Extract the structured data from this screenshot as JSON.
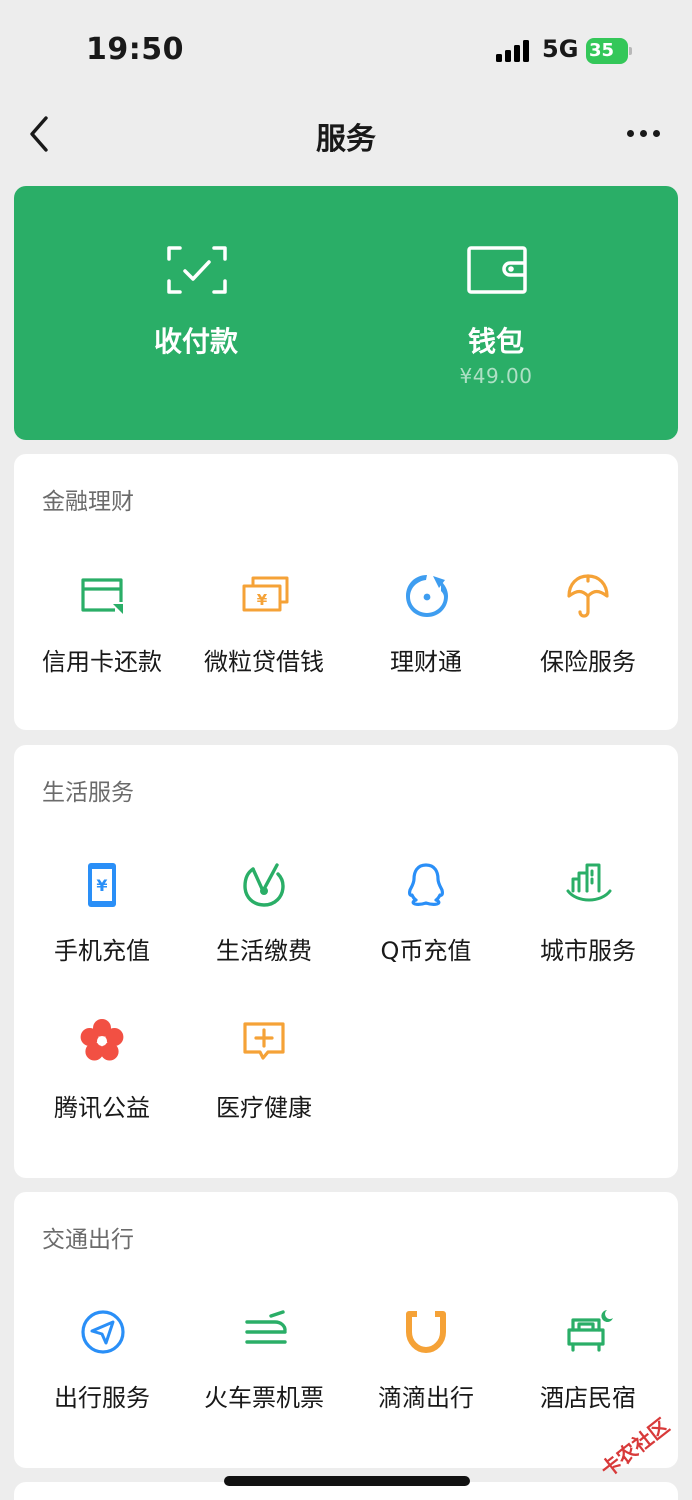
{
  "status": {
    "time": "19:50",
    "network": "5G",
    "battery": "35"
  },
  "nav": {
    "title": "服务",
    "back_icon": "chevron-left-icon",
    "more_icon": "more-dots-icon"
  },
  "wallet_card": {
    "color": "#2aae67",
    "pay": {
      "label": "收付款",
      "icon": "scan-check-icon"
    },
    "wallet": {
      "label": "钱包",
      "balance": "¥49.00",
      "icon": "wallet-icon"
    }
  },
  "sections": [
    {
      "title": "金融理财",
      "items": [
        {
          "label": "信用卡还款",
          "icon": "credit-card-icon",
          "color": "#2aae67"
        },
        {
          "label": "微粒贷借钱",
          "icon": "loan-bill-icon",
          "color": "#f5a237"
        },
        {
          "label": "理财通",
          "icon": "licaitong-icon",
          "color": "#3e9df0"
        },
        {
          "label": "保险服务",
          "icon": "insurance-umbrella-icon",
          "color": "#f5a237"
        }
      ]
    },
    {
      "title": "生活服务",
      "items": [
        {
          "label": "手机充值",
          "icon": "phone-yuan-icon",
          "color": "#2a8ff7"
        },
        {
          "label": "生活缴费",
          "icon": "check-circle-icon",
          "color": "#2aae67"
        },
        {
          "label": "Q币充值",
          "icon": "qq-penguin-icon",
          "color": "#2a8ff7"
        },
        {
          "label": "城市服务",
          "icon": "city-building-icon",
          "color": "#2aae67"
        },
        {
          "label": "腾讯公益",
          "icon": "flower-icon",
          "color": "#f25043"
        },
        {
          "label": "医疗健康",
          "icon": "medical-cross-icon",
          "color": "#f5a237"
        }
      ]
    },
    {
      "title": "交通出行",
      "items": [
        {
          "label": "出行服务",
          "icon": "navigation-arrow-icon",
          "color": "#2a8ff7"
        },
        {
          "label": "火车票机票",
          "icon": "train-plane-icon",
          "color": "#2aae67"
        },
        {
          "label": "滴滴出行",
          "icon": "didi-icon",
          "color": "#f5a237"
        },
        {
          "label": "酒店民宿",
          "icon": "hotel-bed-icon",
          "color": "#2aae67"
        }
      ]
    }
  ],
  "watermark": "卡农社区"
}
